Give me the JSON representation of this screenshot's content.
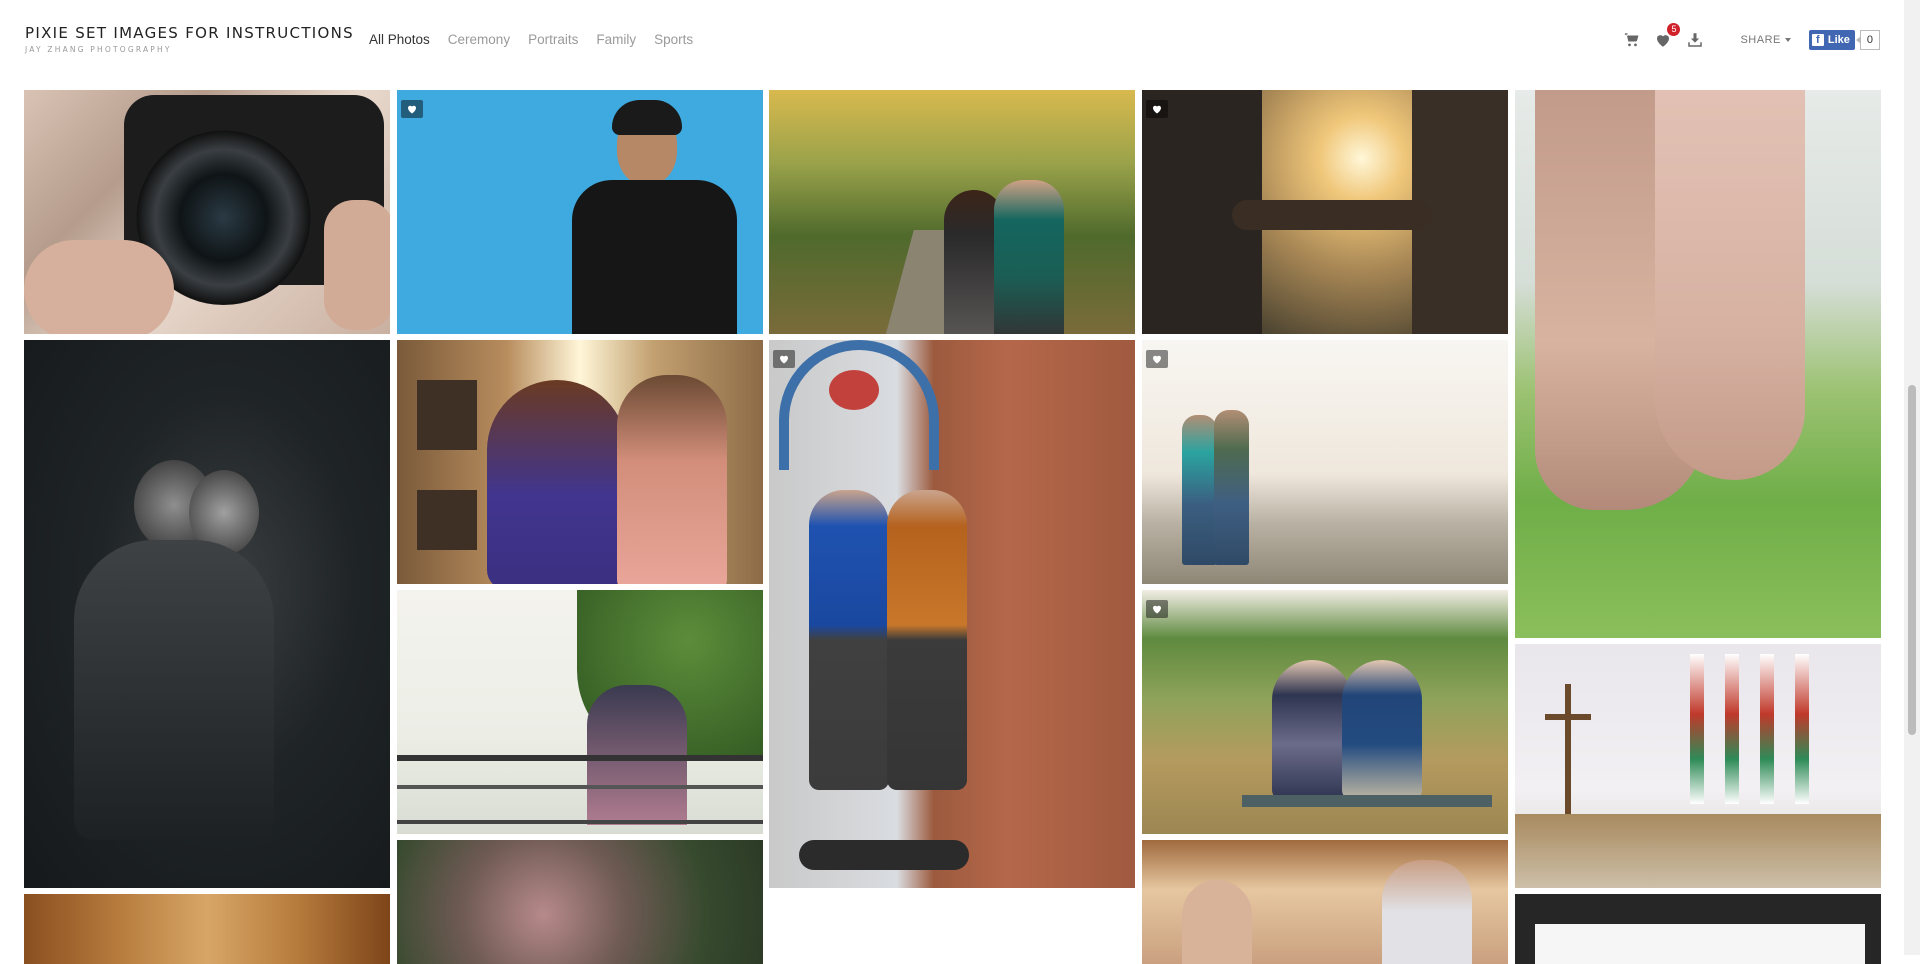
{
  "brand": {
    "title": "PIXIE SET IMAGES FOR INSTRUCTIONS",
    "subtitle": "JAY ZHANG PHOTOGRAPHY"
  },
  "nav": {
    "items": [
      {
        "label": "All Photos",
        "active": true
      },
      {
        "label": "Ceremony",
        "active": false
      },
      {
        "label": "Portraits",
        "active": false
      },
      {
        "label": "Family",
        "active": false
      },
      {
        "label": "Sports",
        "active": false
      }
    ]
  },
  "tools": {
    "cart_icon": "cart-icon",
    "favorites_icon": "heart-icon",
    "favorites_count": "5",
    "download_icon": "download-icon",
    "share_label": "SHARE",
    "fb_like_label": "Like",
    "fb_like_count": "0"
  },
  "colors": {
    "accent": "#4267b2",
    "badge": "#d0212a"
  },
  "photos": [
    {
      "name": "photo-camera-lens",
      "favorite_icon": false
    },
    {
      "name": "photo-man-blue-wall",
      "favorite_icon": true
    },
    {
      "name": "photo-couple-autumn-path",
      "favorite_icon": false
    },
    {
      "name": "photo-holding-hands-sunset",
      "favorite_icon": true
    },
    {
      "name": "photo-holding-hands-closeup",
      "favorite_icon": false
    },
    {
      "name": "photo-bw-couple-embrace",
      "favorite_icon": false
    },
    {
      "name": "photo-couple-sunflare",
      "favorite_icon": false
    },
    {
      "name": "photo-couple-brick-wall",
      "favorite_icon": true
    },
    {
      "name": "photo-couple-overlook",
      "favorite_icon": true
    },
    {
      "name": "photo-couple-railing",
      "favorite_icon": false
    },
    {
      "name": "photo-couple-bench",
      "favorite_icon": true
    },
    {
      "name": "photo-church-ceremony",
      "favorite_icon": false
    },
    {
      "name": "photo-wood-altar",
      "favorite_icon": false
    },
    {
      "name": "photo-pink-flowers",
      "favorite_icon": false
    },
    {
      "name": "photo-wedding-dance",
      "favorite_icon": false
    },
    {
      "name": "photo-dark-screen",
      "favorite_icon": false
    }
  ]
}
